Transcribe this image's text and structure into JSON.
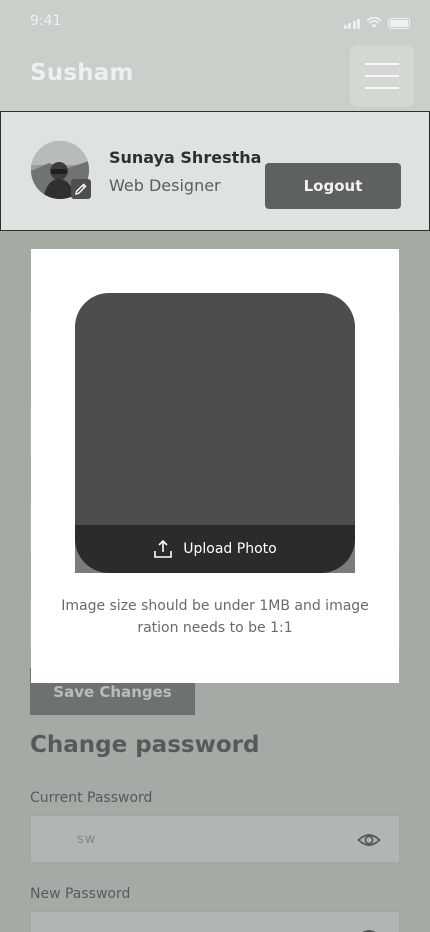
{
  "status_bar": {
    "time": "9:41"
  },
  "header": {
    "brand": "Susham"
  },
  "profile": {
    "name": "Sunaya Shrestha",
    "role": "Web Designer",
    "logout_label": "Logout"
  },
  "form": {
    "save_label": "Save Changes"
  },
  "password": {
    "title": "Change password",
    "current_label": "Current Password",
    "current_value": "sw",
    "new_label": "New Password"
  },
  "modal": {
    "upload_label": "Upload Photo",
    "note": "Image size should be under 1MB and image ration needs to be 1:1"
  },
  "icons": [
    "signal-icon",
    "wifi-icon",
    "battery-icon",
    "menu-icon",
    "edit-icon",
    "upload-icon",
    "eye-icon"
  ]
}
